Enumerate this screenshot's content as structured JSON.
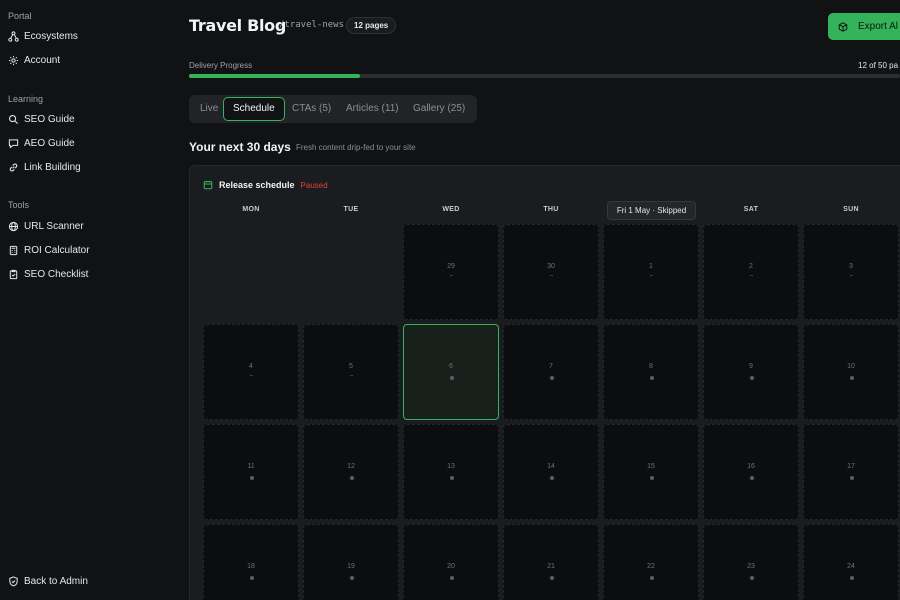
{
  "sidebar": {
    "sections": [
      {
        "heading": "Portal",
        "items": [
          {
            "label": "Ecosystems",
            "icon": "network-icon"
          },
          {
            "label": "Account",
            "icon": "gear-icon"
          }
        ]
      },
      {
        "heading": "Learning",
        "items": [
          {
            "label": "SEO Guide",
            "icon": "search-icon"
          },
          {
            "label": "AEO Guide",
            "icon": "chat-icon"
          },
          {
            "label": "Link Building",
            "icon": "link-icon"
          }
        ]
      },
      {
        "heading": "Tools",
        "items": [
          {
            "label": "URL Scanner",
            "icon": "globe-icon"
          },
          {
            "label": "ROI Calculator",
            "icon": "calculator-icon"
          },
          {
            "label": "SEO Checklist",
            "icon": "clipboard-check-icon"
          }
        ]
      }
    ],
    "back": {
      "label": "Back to Admin",
      "icon": "shield-icon"
    }
  },
  "header": {
    "title": "Travel Blog",
    "slug": "/travel-news",
    "pages_badge": "12 pages",
    "export_label": "Export Al"
  },
  "progress": {
    "label": "Delivery Progress",
    "count_text": "12 of 50 pa",
    "value": 12,
    "max": 50
  },
  "tabs": [
    {
      "label": "Live",
      "active": false
    },
    {
      "label": "Schedule",
      "active": true
    },
    {
      "label": "CTAs (5)",
      "active": false
    },
    {
      "label": "Articles (11)",
      "active": false
    },
    {
      "label": "Gallery (25)",
      "active": false
    }
  ],
  "schedule": {
    "title": "Your next 30 days",
    "subtitle": "Fresh content drip-fed to your site",
    "panel_title": "Release schedule",
    "status": "Paused",
    "status_color": "#e0443e",
    "accent_color": "#34b35a",
    "weekdays": [
      "MON",
      "TUE",
      "WED",
      "THU",
      "FRI",
      "SAT",
      "SUN"
    ],
    "tooltip": "Fri 1 May · Skipped",
    "weeks": [
      [
        {
          "day": null
        },
        {
          "day": null
        },
        {
          "day": "29",
          "mark": "dash"
        },
        {
          "day": "30",
          "mark": "dash"
        },
        {
          "day": "1",
          "mark": "dash"
        },
        {
          "day": "2",
          "mark": "dash"
        },
        {
          "day": "3",
          "mark": "dash"
        }
      ],
      [
        {
          "day": "4",
          "mark": "dash"
        },
        {
          "day": "5",
          "mark": "dash"
        },
        {
          "day": "6",
          "mark": "dot",
          "today": true
        },
        {
          "day": "7",
          "mark": "dot"
        },
        {
          "day": "8",
          "mark": "dot"
        },
        {
          "day": "9",
          "mark": "dot"
        },
        {
          "day": "10",
          "mark": "dot"
        }
      ],
      [
        {
          "day": "11",
          "mark": "dot"
        },
        {
          "day": "12",
          "mark": "dot"
        },
        {
          "day": "13",
          "mark": "dot"
        },
        {
          "day": "14",
          "mark": "dot"
        },
        {
          "day": "15",
          "mark": "dot"
        },
        {
          "day": "16",
          "mark": "dot"
        },
        {
          "day": "17",
          "mark": "dot"
        }
      ],
      [
        {
          "day": "18",
          "mark": "dot"
        },
        {
          "day": "19",
          "mark": "dot"
        },
        {
          "day": "20",
          "mark": "dot"
        },
        {
          "day": "21",
          "mark": "dot"
        },
        {
          "day": "22",
          "mark": "dot"
        },
        {
          "day": "23",
          "mark": "dot"
        },
        {
          "day": "24",
          "mark": "dot"
        }
      ]
    ]
  }
}
